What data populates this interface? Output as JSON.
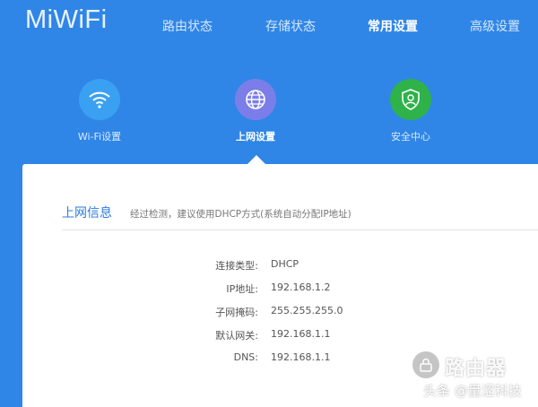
{
  "header": {
    "logo": "MiWiFi",
    "nav": [
      {
        "label": "路由状态",
        "active": false
      },
      {
        "label": "存储状态",
        "active": false
      },
      {
        "label": "常用设置",
        "active": true
      },
      {
        "label": "高级设置",
        "active": false
      }
    ]
  },
  "features": [
    {
      "label": "Wi-Fi设置",
      "icon": "wifi-icon",
      "color": "#3aa0f2"
    },
    {
      "label": "上网设置",
      "icon": "globe-icon",
      "color": "#7b7ee8"
    },
    {
      "label": "安全中心",
      "icon": "shield-user-icon",
      "color": "#2fb24a"
    }
  ],
  "section": {
    "title": "上网信息",
    "description": "经过检测，建议使用DHCP方式(系统自动分配IP地址)"
  },
  "info": [
    {
      "label": "连接类型:",
      "value": "DHCP"
    },
    {
      "label": "IP地址:",
      "value": "192.168.1.2"
    },
    {
      "label": "子网掩码:",
      "value": "255.255.255.0"
    },
    {
      "label": "默认网关:",
      "value": "192.168.1.1"
    },
    {
      "label": "DNS:",
      "value": "192.168.1.1"
    }
  ],
  "watermark": {
    "brand": "路由器",
    "credit": "头条 @量涩科技"
  },
  "colors": {
    "background": "#2f86e6",
    "panel": "#ffffff",
    "accent": "#2c7be0"
  }
}
